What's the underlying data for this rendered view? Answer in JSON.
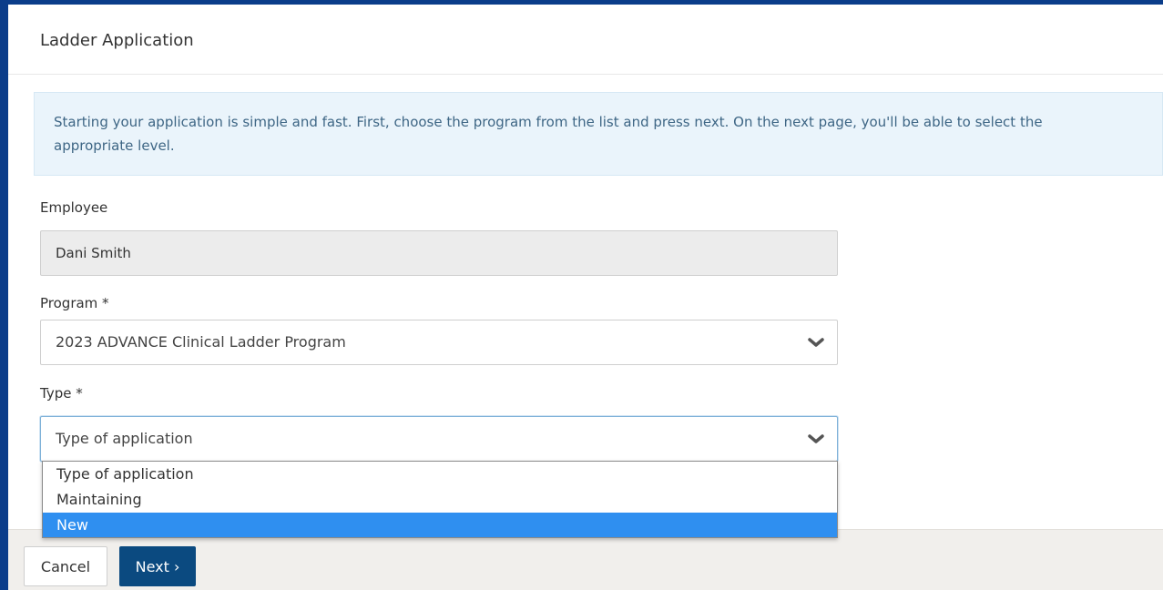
{
  "header": {
    "title": "Ladder Application"
  },
  "alert": {
    "line1": "Starting your application is simple and fast. First, choose the program from the list and press next. On the next page, you'll be able to select the",
    "line2": "appropriate level."
  },
  "employee": {
    "label": "Employee",
    "value": "Dani Smith"
  },
  "program": {
    "label": "Program *",
    "value": "2023 ADVANCE Clinical Ladder Program",
    "icon": "chevron-down-icon"
  },
  "type": {
    "label": "Type *",
    "value": "Type of application",
    "icon": "chevron-down-icon",
    "options": [
      "Type of application",
      "Maintaining",
      "New"
    ],
    "highlighted": "New"
  },
  "footer": {
    "cancel_label": "Cancel",
    "next_label": "Next ›"
  },
  "colors": {
    "frame": "#0b3d8a",
    "primary_button": "#0b4a80",
    "highlight": "#2f8ff0",
    "alert_bg": "#eaf4fb"
  }
}
